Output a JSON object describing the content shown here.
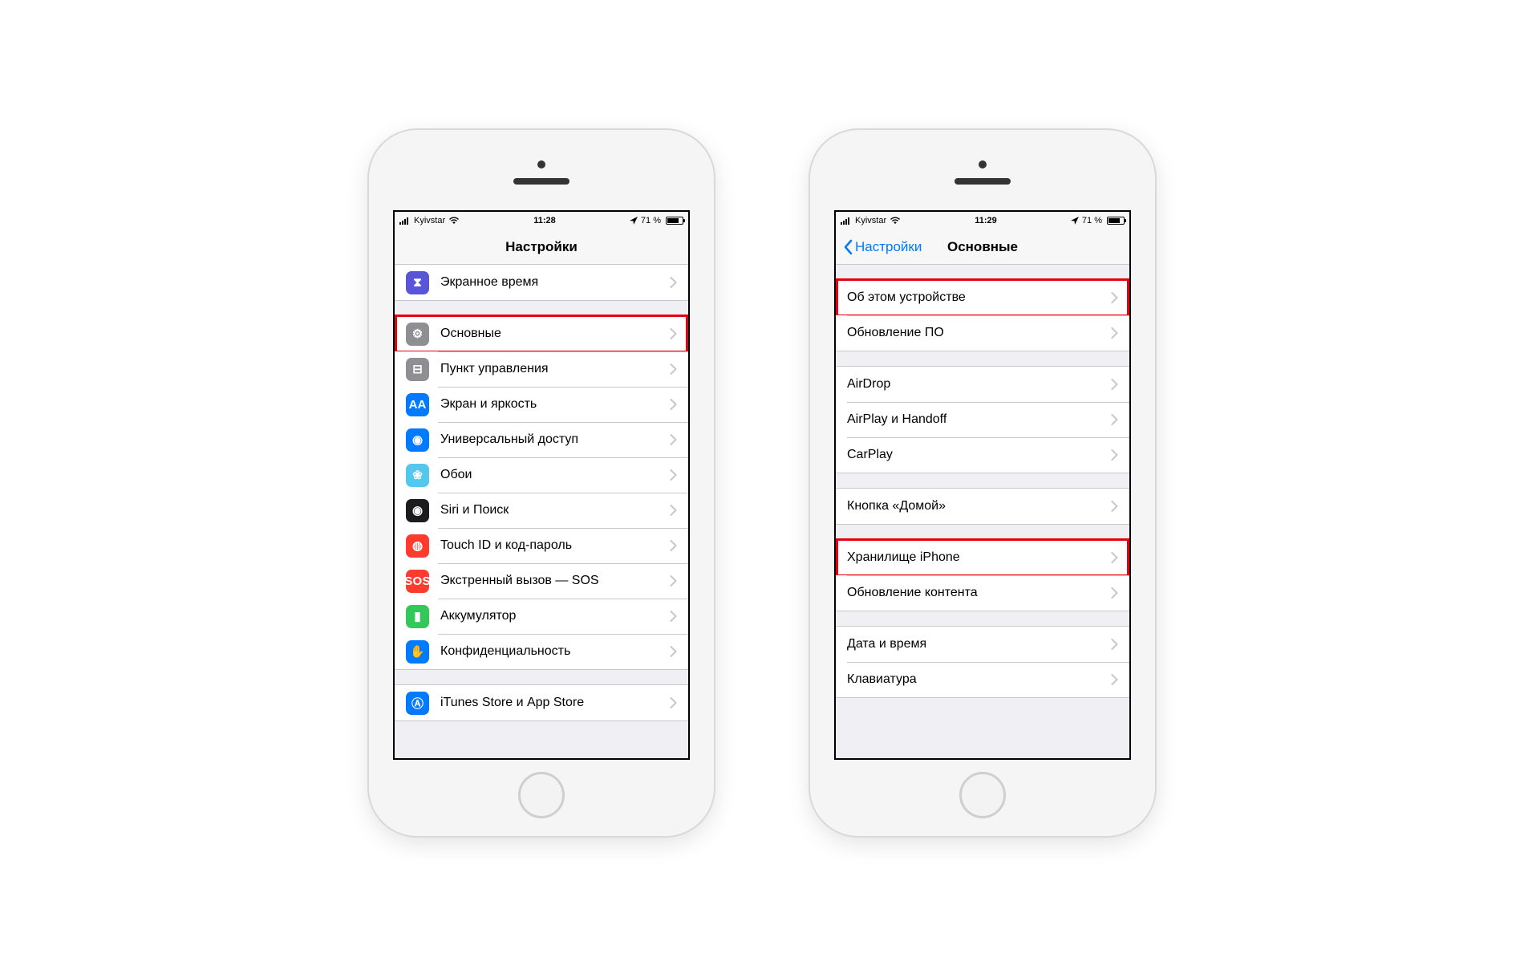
{
  "phoneA": {
    "status": {
      "carrier": "Kyivstar",
      "time": "11:28",
      "battery": "71 %"
    },
    "title": "Настройки",
    "groups": [
      {
        "first": true,
        "rows": [
          {
            "id": "screentime",
            "label": "Экранное время",
            "iconClass": "ic-screentime",
            "glyph": "⧗"
          }
        ]
      },
      {
        "rows": [
          {
            "id": "general",
            "label": "Основные",
            "iconClass": "ic-general",
            "glyph": "⚙",
            "highlight": true
          },
          {
            "id": "control-center",
            "label": "Пункт управления",
            "iconClass": "ic-control",
            "glyph": "⊟"
          },
          {
            "id": "display",
            "label": "Экран и яркость",
            "iconClass": "ic-display",
            "glyph": "AA"
          },
          {
            "id": "accessibility",
            "label": "Универсальный доступ",
            "iconClass": "ic-access",
            "glyph": "◉"
          },
          {
            "id": "wallpaper",
            "label": "Обои",
            "iconClass": "ic-wall",
            "glyph": "❀"
          },
          {
            "id": "siri",
            "label": "Siri и Поиск",
            "iconClass": "ic-siri",
            "glyph": "◉"
          },
          {
            "id": "touchid",
            "label": "Touch ID и код-пароль",
            "iconClass": "ic-touchid",
            "glyph": "◍"
          },
          {
            "id": "sos",
            "label": "Экстренный вызов — SOS",
            "iconClass": "ic-sos",
            "glyph": "SOS"
          },
          {
            "id": "battery",
            "label": "Аккумулятор",
            "iconClass": "ic-battery",
            "glyph": "▮"
          },
          {
            "id": "privacy",
            "label": "Конфиденциальность",
            "iconClass": "ic-privacy",
            "glyph": "✋"
          }
        ]
      },
      {
        "rows": [
          {
            "id": "itunes",
            "label": "iTunes Store и App Store",
            "iconClass": "ic-itunes",
            "glyph": "Ⓐ"
          }
        ]
      }
    ]
  },
  "phoneB": {
    "status": {
      "carrier": "Kyivstar",
      "time": "11:29",
      "battery": "71 %"
    },
    "back": "Настройки",
    "title": "Основные",
    "groups": [
      {
        "rows": [
          {
            "id": "about",
            "label": "Об этом устройстве",
            "highlight": true
          },
          {
            "id": "software-update",
            "label": "Обновление ПО"
          }
        ]
      },
      {
        "rows": [
          {
            "id": "airdrop",
            "label": "AirDrop"
          },
          {
            "id": "airplay-handoff",
            "label": "AirPlay и Handoff"
          },
          {
            "id": "carplay",
            "label": "CarPlay"
          }
        ]
      },
      {
        "rows": [
          {
            "id": "home-button",
            "label": "Кнопка «Домой»"
          }
        ]
      },
      {
        "rows": [
          {
            "id": "iphone-storage",
            "label": "Хранилище iPhone",
            "highlight": true
          },
          {
            "id": "background-refresh",
            "label": "Обновление контента"
          }
        ]
      },
      {
        "rows": [
          {
            "id": "date-time",
            "label": "Дата и время"
          },
          {
            "id": "keyboard",
            "label": "Клавиатура"
          }
        ]
      }
    ]
  }
}
